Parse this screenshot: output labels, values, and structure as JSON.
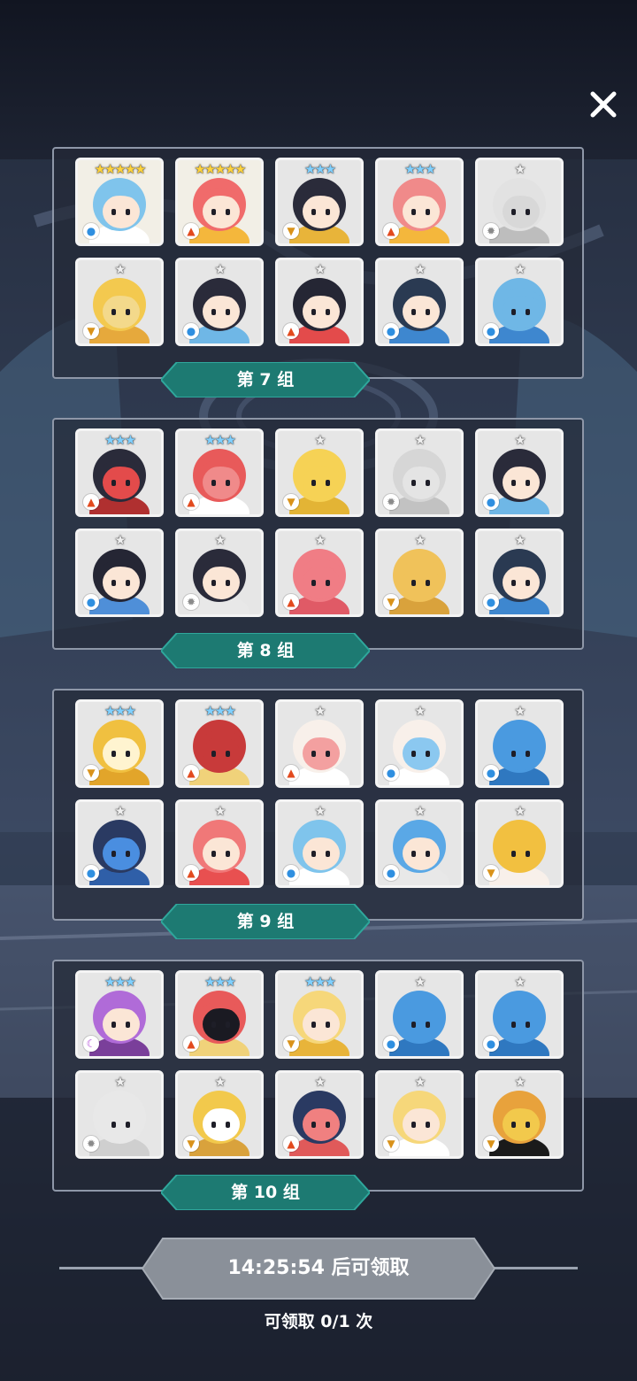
{
  "close_icon": "close-icon",
  "groups": [
    {
      "label": "第 7 组",
      "heroes": [
        {
          "stars": 5,
          "element": "water",
          "hair": "#7fc4ec",
          "face": "#fbe6d6",
          "accent": "#ffffff"
        },
        {
          "stars": 5,
          "element": "fire",
          "hair": "#f06b6b",
          "face": "#fbe6d6",
          "accent": "#f4b73c"
        },
        {
          "stars": 3,
          "element": "earth",
          "hair": "#2a2b3a",
          "face": "#fbe6d6",
          "accent": "#e8b43a"
        },
        {
          "stars": 3,
          "element": "fire",
          "hair": "#f08a8a",
          "face": "#fbe6d6",
          "accent": "#f4b73c"
        },
        {
          "stars": 1,
          "element": "light",
          "hair": "#e2e2e2",
          "face": "#d8d8d8",
          "accent": "#bdbdbd"
        },
        {
          "stars": 1,
          "element": "earth",
          "hair": "#f3c94f",
          "face": "#f3d98b",
          "accent": "#e6a93c"
        },
        {
          "stars": 1,
          "element": "water",
          "hair": "#2a2b3a",
          "face": "#fbe6d6",
          "accent": "#6fb7e6"
        },
        {
          "stars": 1,
          "element": "fire",
          "hair": "#252634",
          "face": "#fbe6d6",
          "accent": "#e34b4b"
        },
        {
          "stars": 1,
          "element": "water",
          "hair": "#2a3a52",
          "face": "#fbe6d6",
          "accent": "#3e87cf"
        },
        {
          "stars": 1,
          "element": "water",
          "hair": "#6fb7e6",
          "face": "#6fb7e6",
          "accent": "#3e87cf"
        }
      ]
    },
    {
      "label": "第 8 组",
      "heroes": [
        {
          "stars": 3,
          "element": "fire",
          "hair": "#2a2b3a",
          "face": "#e34b4b",
          "accent": "#b03030"
        },
        {
          "stars": 3,
          "element": "fire",
          "hair": "#e85a5a",
          "face": "#f08a8a",
          "accent": "#ffffff"
        },
        {
          "stars": 1,
          "element": "earth",
          "hair": "#f6d255",
          "face": "#f6d255",
          "accent": "#e3b435"
        },
        {
          "stars": 1,
          "element": "light",
          "hair": "#d6d6d6",
          "face": "#e4e4e4",
          "accent": "#c2c2c2"
        },
        {
          "stars": 1,
          "element": "water",
          "hair": "#2a2b3a",
          "face": "#fbe6d6",
          "accent": "#6fb7e6"
        },
        {
          "stars": 1,
          "element": "water",
          "hair": "#252634",
          "face": "#fbe6d6",
          "accent": "#4f8fd8"
        },
        {
          "stars": 1,
          "element": "light",
          "hair": "#2a2b3a",
          "face": "#fbe6d6",
          "accent": "#e8e8e8"
        },
        {
          "stars": 1,
          "element": "fire",
          "hair": "#f07d85",
          "face": "#f07d85",
          "accent": "#e05a66"
        },
        {
          "stars": 1,
          "element": "earth",
          "hair": "#f0c25a",
          "face": "#f0c25a",
          "accent": "#d9a23c"
        },
        {
          "stars": 1,
          "element": "water",
          "hair": "#2a3a52",
          "face": "#fbe6d6",
          "accent": "#3e87cf"
        }
      ]
    },
    {
      "label": "第 9 组",
      "heroes": [
        {
          "stars": 3,
          "element": "earth",
          "hair": "#f0c040",
          "face": "#fff4d0",
          "accent": "#e2a52a"
        },
        {
          "stars": 3,
          "element": "fire",
          "hair": "#c83a3a",
          "face": "#c83a3a",
          "accent": "#f0d27a"
        },
        {
          "stars": 1,
          "element": "fire",
          "hair": "#f8f0ea",
          "face": "#f3a0a0",
          "accent": "#ffffff"
        },
        {
          "stars": 1,
          "element": "water",
          "hair": "#f8f0ea",
          "face": "#8bc8f0",
          "accent": "#ffffff"
        },
        {
          "stars": 1,
          "element": "water",
          "hair": "#4a9ae0",
          "face": "#4a9ae0",
          "accent": "#2f78c0"
        },
        {
          "stars": 1,
          "element": "water",
          "hair": "#2a3a62",
          "face": "#4a8ee0",
          "accent": "#2f5fa8"
        },
        {
          "stars": 1,
          "element": "fire",
          "hair": "#f07878",
          "face": "#fbe6d6",
          "accent": "#e85050"
        },
        {
          "stars": 1,
          "element": "water",
          "hair": "#7fc4ec",
          "face": "#fbe6d6",
          "accent": "#ffffff"
        },
        {
          "stars": 1,
          "element": "water",
          "hair": "#5aa8e6",
          "face": "#fbe6d6",
          "accent": "#e8e8e8"
        },
        {
          "stars": 1,
          "element": "earth",
          "hair": "#f2c040",
          "face": "#f2c040",
          "accent": "#f8f0ea"
        }
      ]
    },
    {
      "label": "第 10 组",
      "heroes": [
        {
          "stars": 3,
          "element": "dark",
          "hair": "#b06bd8",
          "face": "#fbe6d6",
          "accent": "#7a3f9a"
        },
        {
          "stars": 3,
          "element": "fire",
          "hair": "#e85a5a",
          "face": "#1a1a22",
          "accent": "#f0d27a"
        },
        {
          "stars": 3,
          "element": "earth",
          "hair": "#f6d77a",
          "face": "#fbe6d6",
          "accent": "#e8b43a"
        },
        {
          "stars": 1,
          "element": "water",
          "hair": "#4a9ae0",
          "face": "#4a9ae0",
          "accent": "#2f78c0"
        },
        {
          "stars": 1,
          "element": "water",
          "hair": "#4a9ae0",
          "face": "#4a9ae0",
          "accent": "#2f78c0"
        },
        {
          "stars": 1,
          "element": "light",
          "hair": "#e8e8e8",
          "face": "#e8e8e8",
          "accent": "#cfcfcf"
        },
        {
          "stars": 1,
          "element": "earth",
          "hair": "#f2c94c",
          "face": "#ffffff",
          "accent": "#d9a23c"
        },
        {
          "stars": 1,
          "element": "fire",
          "hair": "#2a3a62",
          "face": "#f08080",
          "accent": "#e05a5a"
        },
        {
          "stars": 1,
          "element": "earth",
          "hair": "#f6d77a",
          "face": "#fbe6d6",
          "accent": "#ffffff"
        },
        {
          "stars": 1,
          "element": "earth",
          "hair": "#e8a23c",
          "face": "#f2c94c",
          "accent": "#1a1a1a"
        }
      ]
    }
  ],
  "timer": {
    "label": "14:25:54 后可领取"
  },
  "claim_count": "可领取 0/1 次",
  "colors": {
    "banner": "#1d7a72",
    "timer_button": "#8a9099",
    "water": "#2f8fe0",
    "fire": "#e24a1e",
    "earth": "#d9921a",
    "light": "#8a8a8a",
    "dark": "#b34fd8"
  }
}
